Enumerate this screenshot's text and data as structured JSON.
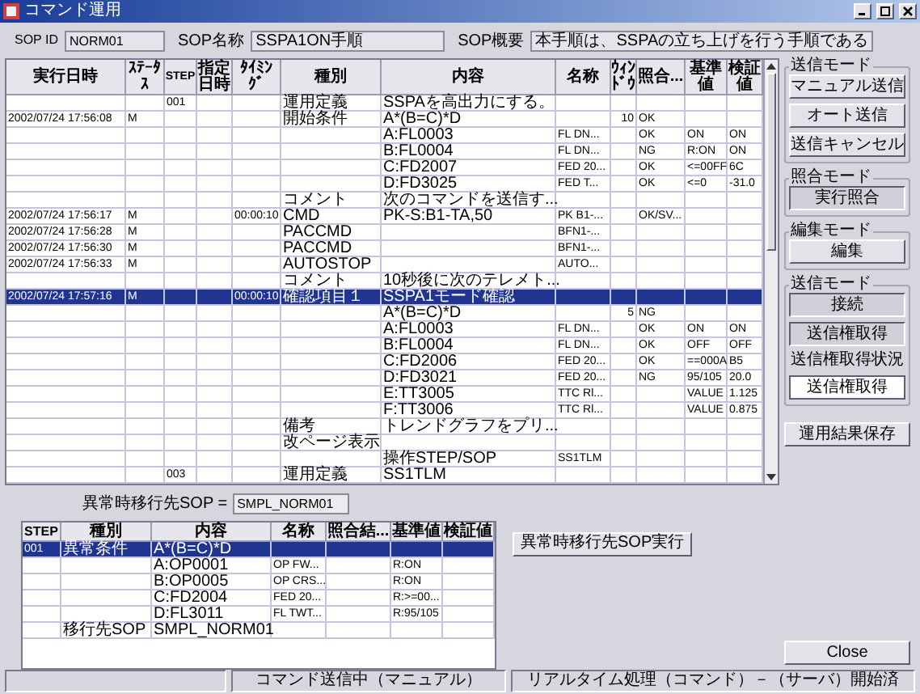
{
  "window": {
    "title": "コマンド運用"
  },
  "sop": {
    "id_label": "SOP ID",
    "id": "NORM01",
    "name_label": "SOP名称",
    "name": "SSPA1ON手順",
    "summary_label": "SOP概要",
    "summary": "本手順は、SSPAの立ち上げを行う手順である"
  },
  "table": {
    "columns": [
      "実行日時",
      "ｽﾃｰﾀｽ",
      "STEP",
      "指定日時",
      "ﾀｲﾐﾝｸﾞ",
      "種別",
      "内容",
      "名称",
      "ｳｨﾝﾄﾞｳ",
      "照合...",
      "基準値",
      "検証値"
    ],
    "rows": [
      {
        "selected": false,
        "step": "001",
        "type": "運用定義",
        "content": "SSPAを高出力にする。"
      },
      {
        "selected": false,
        "date": "2002/07/24 17:56:08",
        "status": "M",
        "type": "開始条件",
        "content": "A*(B=C)*D",
        "window": "10",
        "check": "OK"
      },
      {
        "selected": false,
        "content": "A:FL0003",
        "name": "FL DN...",
        "check": "OK",
        "ref": "ON",
        "verify": "ON"
      },
      {
        "selected": false,
        "content": "B:FL0004",
        "name": "FL DN...",
        "check": "NG",
        "ref": "R:ON",
        "verify": "ON"
      },
      {
        "selected": false,
        "content": "C:FD2007",
        "name": "FED 20...",
        "check": "OK",
        "ref": "<=00FF",
        "verify": "6C"
      },
      {
        "selected": false,
        "content": "D:FD3025",
        "name": "FED T...",
        "check": "OK",
        "ref": "<=0",
        "verify": "-31.0"
      },
      {
        "selected": false,
        "type": "コメント",
        "content": "次のコマンドを送信す..."
      },
      {
        "selected": false,
        "date": "2002/07/24 17:56:17",
        "status": "M",
        "timing": "00:00:10",
        "type": "CMD",
        "content": "PK-S:B1-TA,50",
        "name": "PK B1-...",
        "check": "OK/SV..."
      },
      {
        "selected": false,
        "date": "2002/07/24 17:56:28",
        "status": "M",
        "type": "PACCMD",
        "name": "BFN1-..."
      },
      {
        "selected": false,
        "date": "2002/07/24 17:56:30",
        "status": "M",
        "type": "PACCMD",
        "name": "BFN1-..."
      },
      {
        "selected": false,
        "date": "2002/07/24 17:56:33",
        "status": "M",
        "type": "AUTOSTOP",
        "name": "AUTO..."
      },
      {
        "selected": false,
        "type": "コメント",
        "content": "10秒後に次のテレメト..."
      },
      {
        "selected": true,
        "date": "2002/07/24 17:57:16",
        "status": "M",
        "timing": "00:00:10",
        "type": "確認項目１",
        "content": "SSPA1モード確認"
      },
      {
        "selected": false,
        "content": "A*(B=C)*D",
        "window": "5",
        "check": "NG"
      },
      {
        "selected": false,
        "content": "A:FL0003",
        "name": "FL DN...",
        "check": "OK",
        "ref": "ON",
        "verify": "ON"
      },
      {
        "selected": false,
        "content": "B:FL0004",
        "name": "FL DN...",
        "check": "OK",
        "ref": "OFF",
        "verify": "OFF"
      },
      {
        "selected": false,
        "content": "C:FD2006",
        "name": "FED 20...",
        "check": "OK",
        "ref": "==000A",
        "verify": "B5"
      },
      {
        "selected": false,
        "content": "D:FD3021",
        "name": "FED 20...",
        "check": "NG",
        "ref": "95/105",
        "verify": "20.0"
      },
      {
        "selected": false,
        "content": "E:TT3005",
        "name": "TTC Rl...",
        "ref": "VALUE",
        "verify": "1.125"
      },
      {
        "selected": false,
        "content": "F:TT3006",
        "name": "TTC Rl...",
        "ref": "VALUE",
        "verify": "0.875"
      },
      {
        "selected": false,
        "type": "備考",
        "content": "トレンドグラフをプリ..."
      },
      {
        "selected": false,
        "type": "改ページ表示"
      },
      {
        "selected": false,
        "content": "操作STEP/SOP",
        "name": "SS1TLM"
      },
      {
        "selected": false,
        "step": "003",
        "type": "運用定義",
        "content": "SS1TLM"
      }
    ]
  },
  "fallback": {
    "label": "異常時移行先SOP =",
    "value": "SMPL_NORM01",
    "button": "異常時移行先SOP実行"
  },
  "sub_table": {
    "columns": [
      "STEP",
      "種別",
      "内容",
      "名称",
      "照合結...",
      "基準値",
      "検証値"
    ],
    "rows": [
      {
        "selected": true,
        "step": "001",
        "type": "異常条件",
        "content": "A*(B=C)*D"
      },
      {
        "selected": false,
        "content": "A:OP0001",
        "name": "OP FW...",
        "ref": "R:ON"
      },
      {
        "selected": false,
        "content": "B:OP0005",
        "name": "OP CRS...",
        "ref": "R:ON"
      },
      {
        "selected": false,
        "content": "C:FD2004",
        "name": "FED 20...",
        "ref": "R:>=00..."
      },
      {
        "selected": false,
        "content": "D:FL3011",
        "name": "FL TWT...",
        "ref": "R:95/105"
      },
      {
        "selected": false,
        "type": "移行先SOP",
        "content": "SMPL_NORM01"
      }
    ]
  },
  "panels": [
    {
      "title": "送信モード",
      "items": [
        {
          "kind": "button",
          "label": "マニュアル送信",
          "pressed": false
        },
        {
          "kind": "button",
          "label": "オート送信",
          "pressed": false
        },
        {
          "kind": "button",
          "label": "送信キャンセル",
          "pressed": false
        }
      ]
    },
    {
      "title": "照合モード",
      "items": [
        {
          "kind": "button",
          "label": "実行照合",
          "pressed": true
        }
      ]
    },
    {
      "title": "編集モード",
      "items": [
        {
          "kind": "button",
          "label": "編集",
          "pressed": false
        }
      ]
    },
    {
      "title": "送信モード",
      "items": [
        {
          "kind": "button",
          "label": "接続",
          "pressed": true
        },
        {
          "kind": "button",
          "label": "送信権取得",
          "pressed": true
        },
        {
          "kind": "caption",
          "label": "送信権取得状況"
        },
        {
          "kind": "indicator",
          "label": "送信権取得"
        }
      ]
    }
  ],
  "save_button": "運用結果保存",
  "close_button": "Close",
  "status_bar": {
    "message": "コマンド送信中（マニュアル）",
    "connection": "リアルタイム処理（コマンド）－（サーバ）開始済"
  }
}
